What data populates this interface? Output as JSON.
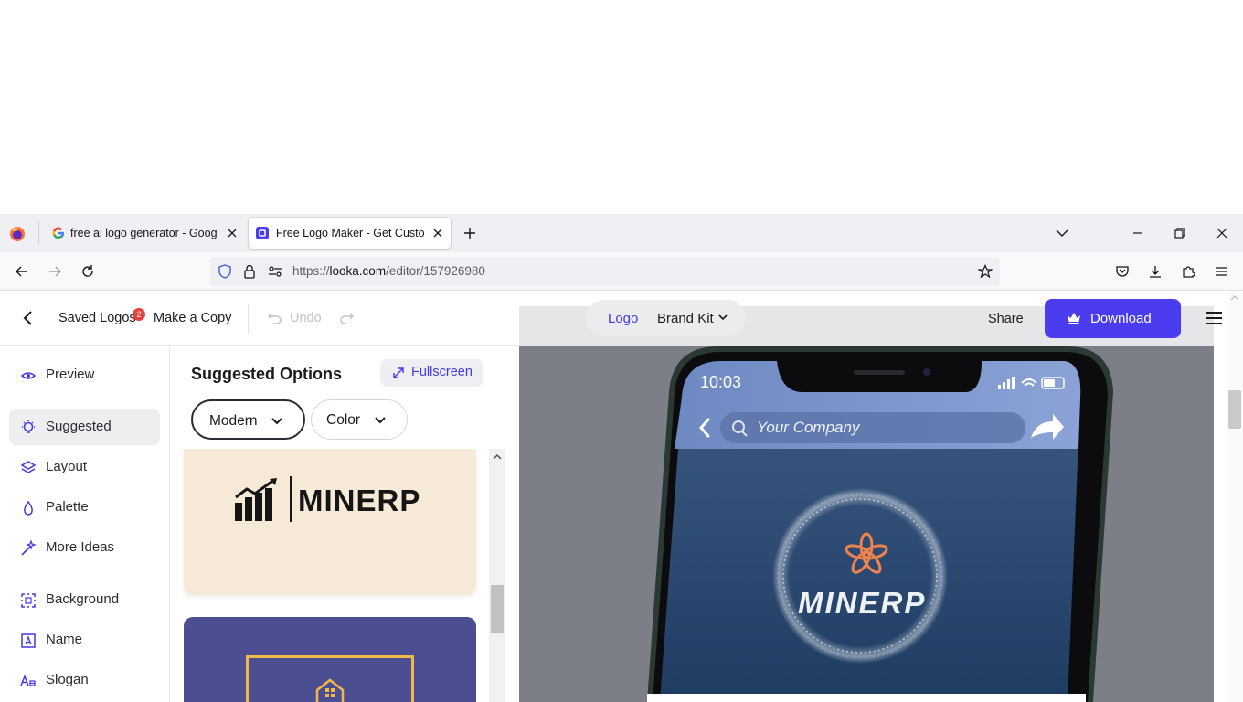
{
  "browser": {
    "tabs": [
      {
        "title": "free ai logo generator - Google Search",
        "favicon": "google-icon",
        "active": false
      },
      {
        "title": "Free Logo Maker - Get Custom Logo Designs",
        "favicon": "looka-icon",
        "active": true
      }
    ],
    "url": {
      "prefix": "https://",
      "host": "looka.com",
      "path": "/editor/157926980"
    }
  },
  "topbar": {
    "saved_logos": "Saved Logos",
    "saved_logos_badge": "2",
    "make_copy": "Make a Copy",
    "undo": "Undo",
    "segment": {
      "logo": "Logo",
      "brand_kit": "Brand Kit"
    },
    "share": "Share",
    "download": "Download"
  },
  "sidebar": {
    "items": [
      {
        "label": "Preview",
        "icon": "eye-icon"
      },
      {
        "label": "Suggested",
        "icon": "lightbulb-icon",
        "selected": true
      },
      {
        "label": "Layout",
        "icon": "layers-icon"
      },
      {
        "label": "Palette",
        "icon": "droplet-icon"
      },
      {
        "label": "More Ideas",
        "icon": "magic-wand-icon"
      },
      {
        "label": "Background",
        "icon": "background-grid-icon"
      },
      {
        "label": "Name",
        "icon": "text-box-icon"
      },
      {
        "label": "Slogan",
        "icon": "slogan-icon"
      }
    ]
  },
  "panel": {
    "title": "Suggested Options",
    "fullscreen": "Fullscreen",
    "filters": {
      "style": "Modern",
      "color": "Color"
    },
    "cards": [
      {
        "logo_text": "MINERP",
        "bg": "#f7e9d7"
      },
      {
        "logo_text": "",
        "bg": "#4b4f92"
      }
    ]
  },
  "phone": {
    "time": "10:03",
    "search_placeholder": "Your Company",
    "logo_text": "MINERP"
  },
  "colors": {
    "accent": "#4b3cf0",
    "link": "#4438e8",
    "badge": "#e8423f"
  }
}
